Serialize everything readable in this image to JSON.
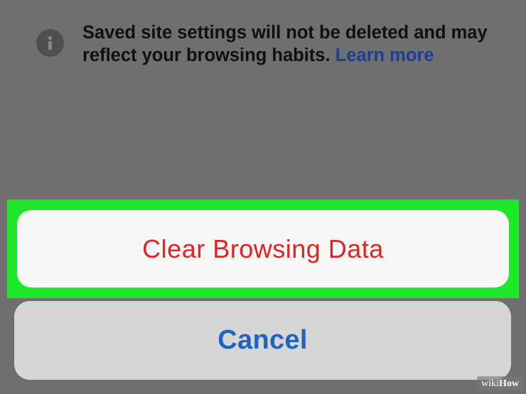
{
  "info": {
    "icon": "info-icon",
    "message": "Saved site settings will not be deleted and may reflect your browsing habits.",
    "link_label": "Learn more"
  },
  "actions": {
    "clear_label": "Clear Browsing Data",
    "cancel_label": "Cancel"
  },
  "watermark": {
    "prefix": "wiki",
    "suffix": "How"
  },
  "colors": {
    "overlay_background": "#6f6f6f",
    "highlight": "#1fe82c",
    "destructive_text": "#e2231f",
    "cancel_text": "#1f63c8",
    "link_text": "#1c3f8f"
  }
}
